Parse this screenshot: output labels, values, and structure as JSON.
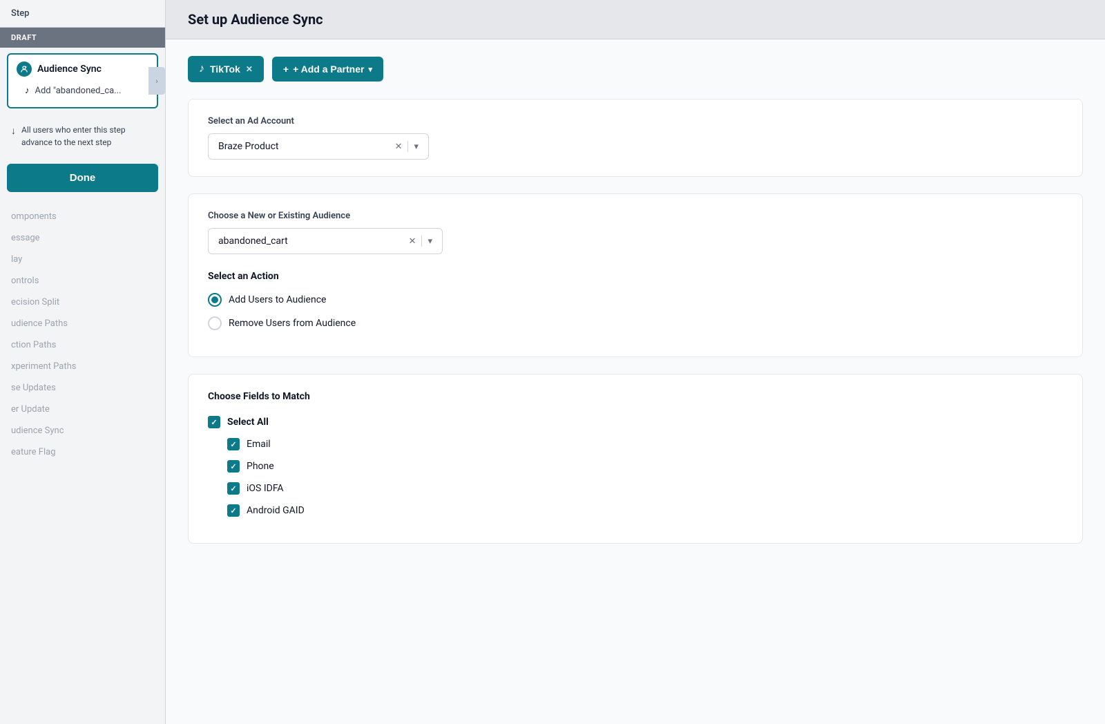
{
  "sidebar": {
    "step_label": "Step",
    "draft_label": "DRAFT",
    "audience_sync_label": "Audience Sync",
    "add_abandoned_label": "Add \"abandoned_ca...",
    "info_text": "All users who enter this step advance to the next step",
    "done_button": "Done",
    "nav_items": [
      {
        "label": "omponents",
        "section": null
      },
      {
        "label": "essage",
        "section": null
      },
      {
        "label": "lay",
        "section": null
      },
      {
        "label": "ontrols",
        "section": null
      },
      {
        "label": "ecision Split",
        "section": null
      },
      {
        "label": "udience Paths",
        "section": null
      },
      {
        "label": "ction Paths",
        "section": null
      },
      {
        "label": "xperiment Paths",
        "section": null
      },
      {
        "label": "se Updates",
        "section": null
      },
      {
        "label": "er Update",
        "section": null
      },
      {
        "label": "udience Sync",
        "section": null
      },
      {
        "label": "eature Flag",
        "section": null
      }
    ]
  },
  "main": {
    "title": "Set up Audience Sync",
    "tiktok_button": "TikTok",
    "add_partner_button": "+ Add a Partner",
    "ad_account_label": "Select an Ad Account",
    "ad_account_value": "Braze Product",
    "audience_label": "Choose a New or Existing Audience",
    "audience_value": "abandoned_cart",
    "action_title": "Select an Action",
    "add_users_label": "Add Users to Audience",
    "remove_users_label": "Remove Users from Audience",
    "fields_title": "Choose Fields to Match",
    "select_all_label": "Select All",
    "field_email": "Email",
    "field_phone": "Phone",
    "field_ios": "iOS IDFA",
    "field_android": "Android GAID"
  }
}
